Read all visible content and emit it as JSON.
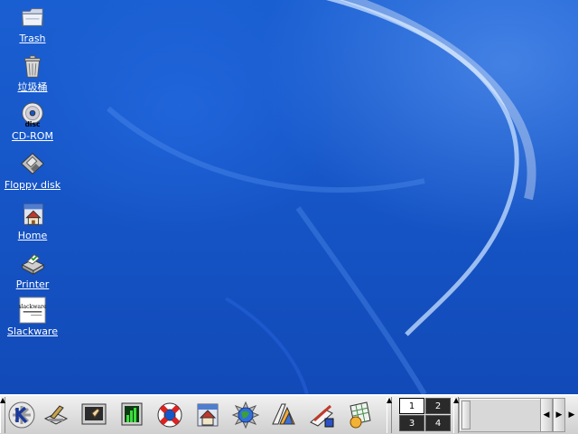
{
  "desktop": {
    "icons": [
      {
        "label": "Trash",
        "icon": "folder-trash-icon"
      },
      {
        "label": "垃圾桶",
        "icon": "trash-can-icon"
      },
      {
        "label": "CD-ROM",
        "icon": "cdrom-disc-icon"
      },
      {
        "label": "Floppy disk",
        "icon": "floppy-disk-icon"
      },
      {
        "label": "Home",
        "icon": "home-folder-icon"
      },
      {
        "label": "Printer",
        "icon": "printer-icon"
      },
      {
        "label": "Slackware",
        "icon": "slackware-logo-icon"
      }
    ],
    "slackware_logo_text": "slackware",
    "cdrom_disc_text": "disc"
  },
  "taskbar": {
    "launchers": [
      {
        "name": "kde-menu-icon"
      },
      {
        "name": "konqueror-tool-icon"
      },
      {
        "name": "terminal-icon"
      },
      {
        "name": "system-monitor-icon"
      },
      {
        "name": "help-lifebuoy-icon"
      },
      {
        "name": "home-browser-icon"
      },
      {
        "name": "web-globe-icon"
      },
      {
        "name": "office-suite-icon"
      },
      {
        "name": "editor-icon"
      },
      {
        "name": "spreadsheet-icon"
      }
    ],
    "pager": {
      "desktops": [
        "1",
        "2",
        "3",
        "4"
      ],
      "active": "1"
    }
  },
  "colors": {
    "desktop_blue": "#1656c8",
    "taskbar_gray": "#d8d8d8"
  }
}
